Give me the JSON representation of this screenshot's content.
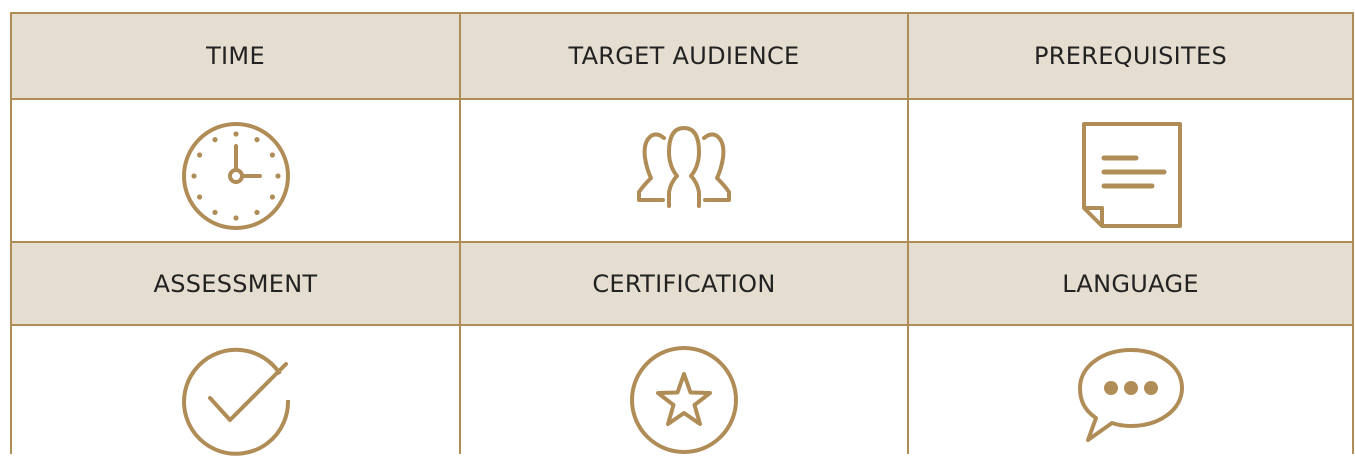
{
  "theme": {
    "accent": "#b08d57",
    "header_bg": "#e6ddd1",
    "text": "#222222"
  },
  "rows": [
    {
      "headers": [
        "TIME",
        "TARGET AUDIENCE",
        "PREREQUISITES"
      ],
      "icons": [
        "clock-icon",
        "people-group-icon",
        "document-note-icon"
      ]
    },
    {
      "headers": [
        "ASSESSMENT",
        "CERTIFICATION",
        "LANGUAGE"
      ],
      "icons": [
        "checkmark-circle-icon",
        "star-circle-icon",
        "speech-bubble-icon"
      ]
    }
  ]
}
